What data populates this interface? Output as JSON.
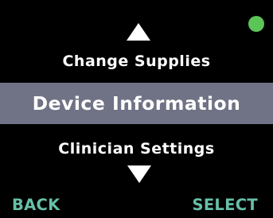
{
  "colors": {
    "background": "#000000",
    "text": "#ffffff",
    "highlight": "#707285",
    "softkey": "#67bfa8",
    "status": "#5cc558"
  },
  "status_indicator": {
    "icon": "status-dot-icon",
    "state": "green"
  },
  "nav": {
    "up_icon": "up-arrow-icon",
    "down_icon": "down-arrow-icon"
  },
  "menu": {
    "items": [
      {
        "label": "Change Supplies"
      },
      {
        "label": "Device Information",
        "selected": true
      },
      {
        "label": "Clinician Settings"
      }
    ]
  },
  "softkeys": {
    "back": "BACK",
    "select": "SELECT"
  }
}
